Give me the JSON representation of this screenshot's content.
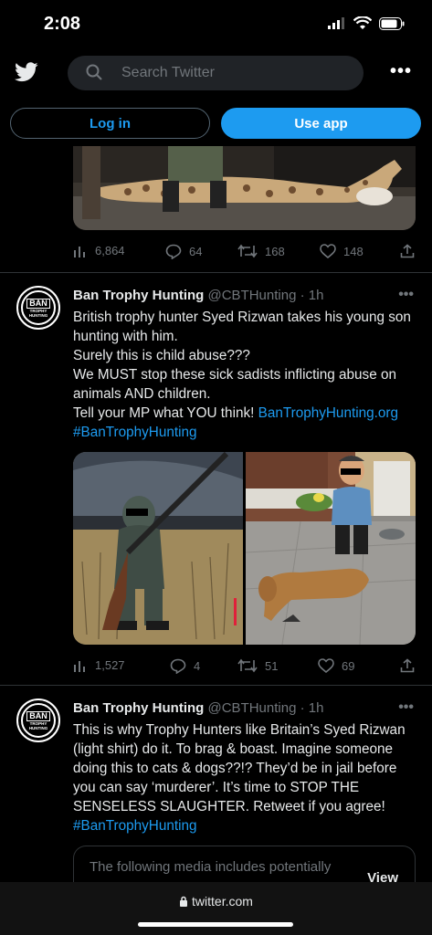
{
  "status_bar": {
    "time": "2:08"
  },
  "header": {
    "search_placeholder": "Search Twitter",
    "more_label": "•••",
    "login_label": "Log in",
    "use_app_label": "Use app"
  },
  "tweet0": {
    "stats": {
      "views": "6,864",
      "replies": "64",
      "retweets": "168",
      "likes": "148"
    }
  },
  "tweet1": {
    "name": "Ban Trophy Hunting",
    "handle": "@CBTHunting · 1h",
    "more": "•••",
    "lines": [
      "British trophy hunter Syed Rizwan takes his young son",
      "hunting with him.",
      "Surely this is child abuse???",
      "We MUST stop these sick sadists inflicting abuse on",
      "animals AND children.",
      "Tell your MP what YOU think!"
    ],
    "link": "BanTrophyHunting.org",
    "hashtag": "#BanTrophyHunting",
    "stats": {
      "views": "1,527",
      "replies": "4",
      "retweets": "51",
      "likes": "69"
    }
  },
  "tweet2": {
    "name": "Ban Trophy Hunting",
    "handle": "@CBTHunting · 1h",
    "more": "•••",
    "lines": [
      "This is why Trophy Hunters like Britain’s Syed Rizwan",
      "(light shirt) do it. To brag & boast. Imagine someone",
      "doing this to cats & dogs??!? They’d be in jail before",
      "you can say ‘murderer’. It’s time to STOP THE",
      "SENSELESS SLAUGHTER. Retweet if you agree!"
    ],
    "hashtag": "#BanTrophyHunting",
    "sensitive_text": "The following media includes potentially",
    "sensitive_view": "View"
  },
  "avatar_logo": {
    "word": "BAN",
    "sub1": "TROPHY",
    "sub2": "HUNTING"
  },
  "footer": {
    "url": "twitter.com"
  }
}
